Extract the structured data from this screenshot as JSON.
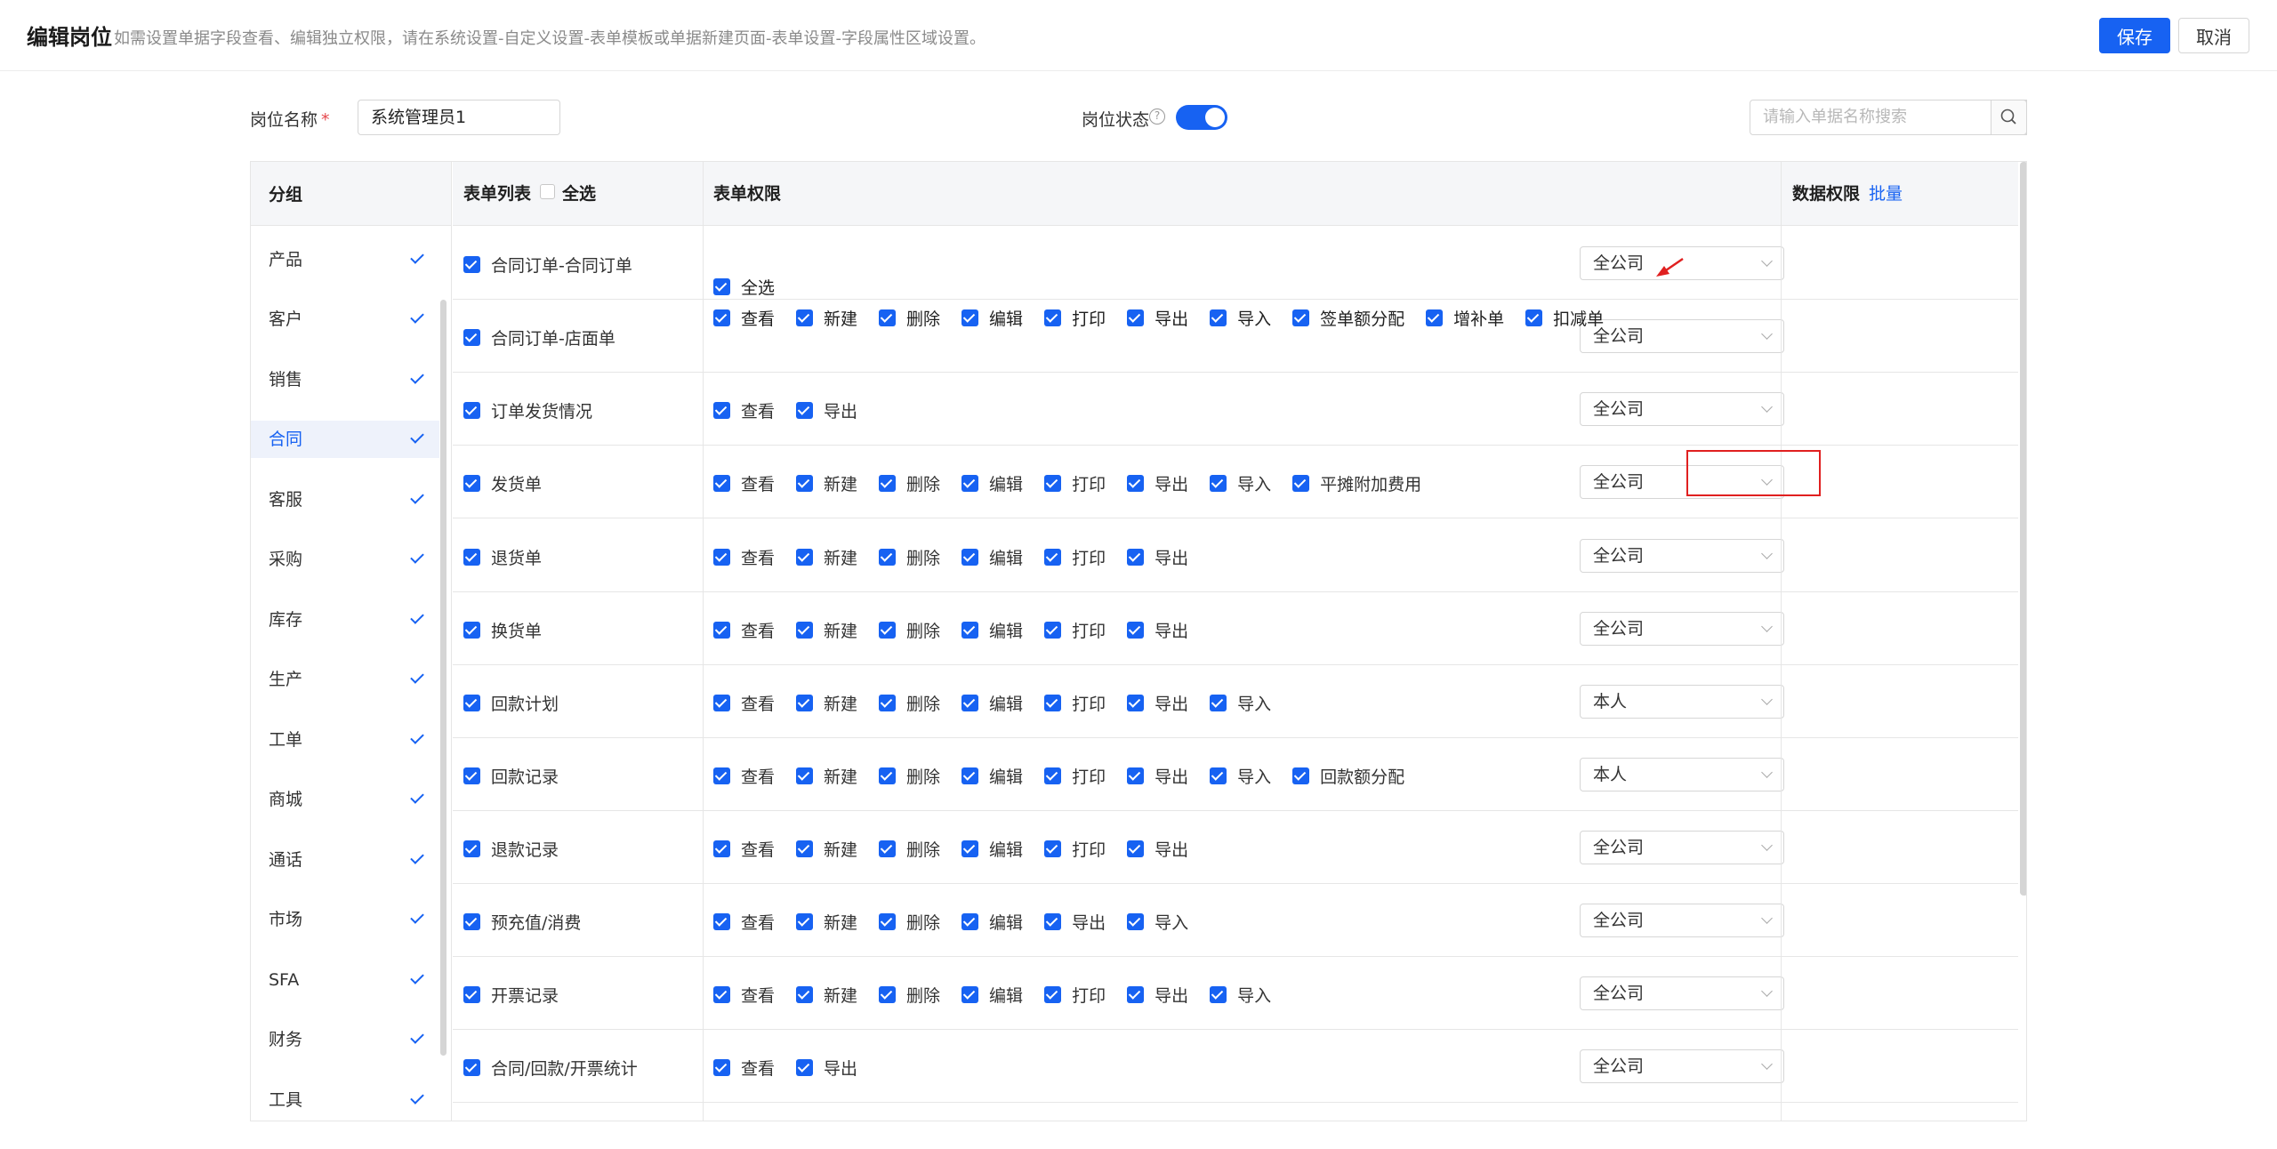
{
  "header": {
    "title": "编辑岗位",
    "hint": "如需设置单据字段查看、编辑独立权限，请在系统设置-自定义设置-表单模板或单据新建页面-表单设置-字段属性区域设置。",
    "save_label": "保存",
    "cancel_label": "取消"
  },
  "form": {
    "name_label": "岗位名称",
    "required_mark": "*",
    "name_value": "系统管理员1",
    "status_label": "岗位状态",
    "status_on": true,
    "search_placeholder": "请输入单据名称搜索"
  },
  "sidebar": {
    "header": "分组",
    "items": [
      {
        "label": "产品",
        "active": false
      },
      {
        "label": "客户",
        "active": false
      },
      {
        "label": "销售",
        "active": false
      },
      {
        "label": "合同",
        "active": true
      },
      {
        "label": "客服",
        "active": false
      },
      {
        "label": "采购",
        "active": false
      },
      {
        "label": "库存",
        "active": false
      },
      {
        "label": "生产",
        "active": false
      },
      {
        "label": "工单",
        "active": false
      },
      {
        "label": "商城",
        "active": false
      },
      {
        "label": "通话",
        "active": false
      },
      {
        "label": "市场",
        "active": false
      },
      {
        "label": "SFA",
        "active": false
      },
      {
        "label": "财务",
        "active": false
      },
      {
        "label": "工具",
        "active": false
      }
    ]
  },
  "table": {
    "col_forms": "表单列表",
    "col_select_all": "全选",
    "col_perms": "表单权限",
    "col_data": "数据权限",
    "col_batch": "批量",
    "group_select_all": "全选",
    "group_perms": [
      "查看",
      "新建",
      "删除",
      "编辑",
      "打印",
      "导出",
      "导入",
      "签单额分配",
      "增补单",
      "扣减单"
    ],
    "rows": [
      {
        "form": "合同订单-合同订单",
        "data": "全公司"
      },
      {
        "form": "合同订单-店面单",
        "data": "全公司"
      },
      {
        "form": "订单发货情况",
        "perms": [
          "查看",
          "导出"
        ],
        "data": "全公司"
      },
      {
        "form": "发货单",
        "perms": [
          "查看",
          "新建",
          "删除",
          "编辑",
          "打印",
          "导出",
          "导入",
          "平摊附加费用"
        ],
        "data": "全公司"
      },
      {
        "form": "退货单",
        "perms": [
          "查看",
          "新建",
          "删除",
          "编辑",
          "打印",
          "导出"
        ],
        "data": "全公司"
      },
      {
        "form": "换货单",
        "perms": [
          "查看",
          "新建",
          "删除",
          "编辑",
          "打印",
          "导出"
        ],
        "data": "全公司"
      },
      {
        "form": "回款计划",
        "perms": [
          "查看",
          "新建",
          "删除",
          "编辑",
          "打印",
          "导出",
          "导入"
        ],
        "data": "本人"
      },
      {
        "form": "回款记录",
        "perms": [
          "查看",
          "新建",
          "删除",
          "编辑",
          "打印",
          "导出",
          "导入",
          "回款额分配"
        ],
        "data": "本人"
      },
      {
        "form": "退款记录",
        "perms": [
          "查看",
          "新建",
          "删除",
          "编辑",
          "打印",
          "导出"
        ],
        "data": "全公司"
      },
      {
        "form": "预充值/消费",
        "perms": [
          "查看",
          "新建",
          "删除",
          "编辑",
          "导出",
          "导入"
        ],
        "data": "全公司"
      },
      {
        "form": "开票记录",
        "perms": [
          "查看",
          "新建",
          "删除",
          "编辑",
          "打印",
          "导出",
          "导入"
        ],
        "data": "全公司"
      },
      {
        "form": "合同/回款/开票统计",
        "perms": [
          "查看",
          "导出"
        ],
        "data": "全公司"
      }
    ]
  },
  "colors": {
    "accent": "#1762f2",
    "highlight": "#e02020"
  }
}
